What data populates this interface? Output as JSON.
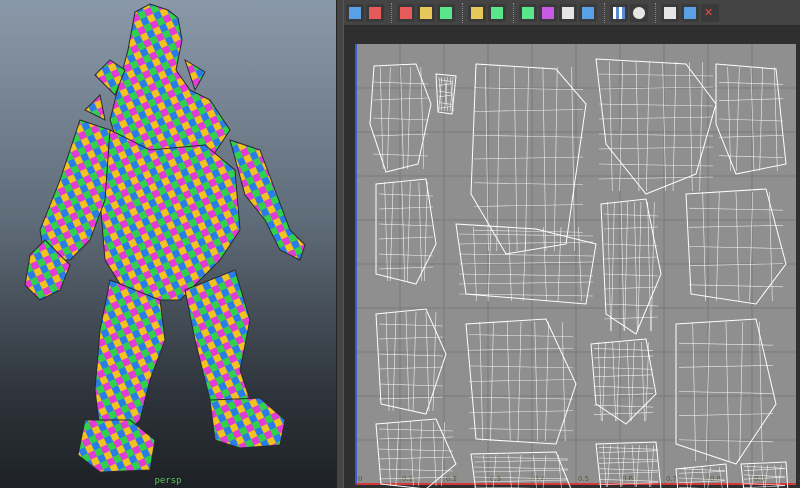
{
  "viewport": {
    "camera_label": "persp"
  },
  "uv_editor": {
    "toolbar_groups": [
      {
        "name": "selection-tools",
        "icons": [
          "uv-select-icon",
          "uv-move-icon"
        ]
      },
      {
        "name": "cut-sew-tools",
        "icons": [
          "cut-uv-icon",
          "sew-uv-icon",
          "unfold-uv-icon"
        ]
      },
      {
        "name": "layout-tools",
        "icons": [
          "layout-uv-icon",
          "relax-uv-icon"
        ]
      },
      {
        "name": "align-tools",
        "icons": [
          "align-left-icon",
          "align-center-icon",
          "align-right-icon",
          "align-top-icon"
        ]
      },
      {
        "name": "display-tools",
        "icons": [
          "checker-icon",
          "help-icon"
        ]
      },
      {
        "name": "stats-tools",
        "icons": [
          "histogram-icon",
          "grid-display-icon",
          "close-icon"
        ]
      }
    ],
    "axis_ticks": [
      "0",
      "0.1",
      "0.2",
      "0.3",
      "0.4",
      "0.5",
      "0.6",
      "0.7",
      "0.8",
      "0.9",
      "1"
    ],
    "colors": {
      "grid_bg": "#8f8f8f",
      "grid_line": "#7a7a7a",
      "uv_wire": "#ffffff",
      "u_axis": "#d23a3a",
      "v_axis": "#3a5ad2"
    }
  }
}
